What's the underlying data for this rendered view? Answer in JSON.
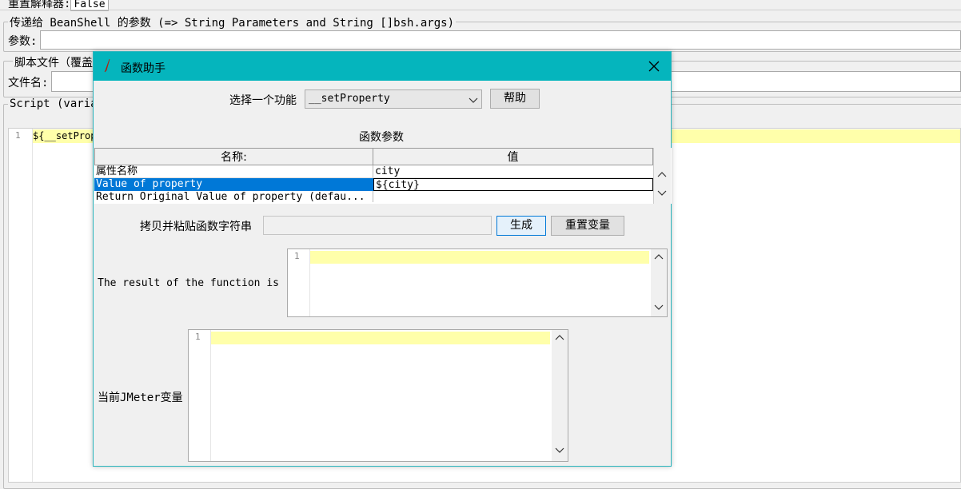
{
  "bg": {
    "reset_label": "重置解释器:",
    "reset_value": "False",
    "params_group_title": "传递给 BeanShell 的参数 (=> String Parameters and String []bsh.args)",
    "params_label": "参数:",
    "script_file_group_title": "脚本文件（覆盖",
    "filename_label": "文件名:",
    "script_group_title": "Script (varia",
    "editor_line_no": "1",
    "editor_text": "${__setProp"
  },
  "dialog": {
    "title": "函数助手",
    "function_label": "选择一个功能",
    "function_value": "__setProperty",
    "help_button": "帮助",
    "params_title": "函数参数",
    "table": {
      "headers": [
        "名称:",
        "值"
      ],
      "rows": [
        {
          "name": "属性名称",
          "value": "city"
        },
        {
          "name": "Value of property",
          "value": "${city}"
        },
        {
          "name": "Return Original Value of property (defau...",
          "value": ""
        }
      ]
    },
    "copy_label": "拷贝并粘贴函数字符串",
    "copy_value": "",
    "generate_button": "生成",
    "reset_vars_button": "重置变量",
    "result_label": "The result of the function is",
    "result_line_no": "1",
    "vars_label": "当前JMeter变量",
    "vars_line_no": "1"
  },
  "colors": {
    "titlebar": "#05b5bd",
    "selection": "#0078d7",
    "highlight_line": "#ffffaa"
  }
}
